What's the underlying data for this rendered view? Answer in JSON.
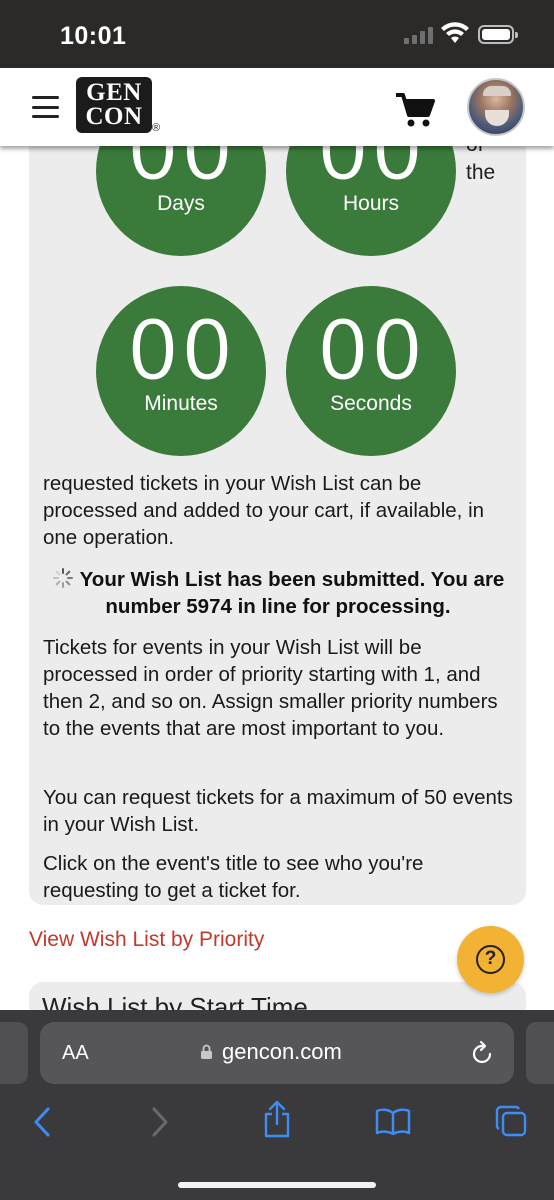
{
  "status": {
    "time": "10:01"
  },
  "header": {
    "logo_line1": "GEN",
    "logo_line2": "CON",
    "logo_reg": "®"
  },
  "countdown": {
    "days_value": "00",
    "days_label": "Days",
    "hours_value": "00",
    "hours_label": "Hours",
    "minutes_value": "00",
    "minutes_label": "Minutes",
    "seconds_value": "00",
    "seconds_label": "Seconds",
    "side_line1": "of",
    "side_line2": "the"
  },
  "body": {
    "para1": "requested tickets in your Wish List can be processed and added to your cart, if available, in one operation.",
    "notice": "Your Wish List has been submitted. You are number 5974 in line for processing.",
    "para2": "Tickets for events in your Wish List will be processed in order of priority starting with 1, and then 2, and so on. Assign smaller priority numbers to the events that are most important to you.",
    "para3": "You can request tickets for a maximum of 50 events in your Wish List.",
    "para4": "Click on the event's title to see who you're requesting to get a ticket for.",
    "link": "View Wish List by Priority",
    "section_title": "Wish List by Start Time",
    "help": "?"
  },
  "browser": {
    "aa": "AA",
    "url": "gencon.com"
  },
  "colors": {
    "accent_green": "#3a7a3a",
    "link_red": "#c0392b",
    "help_yellow": "#f2b234"
  }
}
